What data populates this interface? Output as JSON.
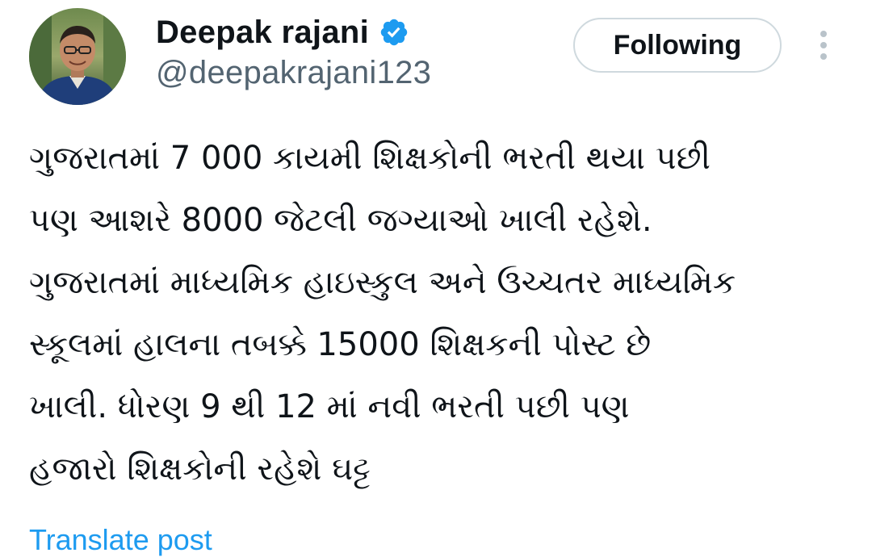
{
  "author": {
    "display_name": "Deepak rajani",
    "handle": "@deepakrajani123",
    "verified_icon": "verified-badge-icon",
    "verified_color": "#1d9bf0"
  },
  "actions": {
    "follow_label": "Following",
    "more_icon": "more-vertical-icon"
  },
  "tweet": {
    "lines": [
      "ગુજરાતમાં 7 000 કાયમી શિક્ષકોની ભરતી થયા પછી",
      "પણ આશરે 8000 જેટલી જગ્યાઓ ખાલી રહેશે.",
      "ગુજરાતમાં માધ્યમિક હાઇસ્કુલ અને ઉચ્ચતર માધ્યમિક",
      "સ્કૂલમાં હાલના તબક્કે 15000 શિક્ષકની પોસ્ટ છે",
      "ખાલી. ધોરણ 9 થી 12 માં નવી ભરતી પછી પણ",
      "હજારો શિક્ષકોની રહેશે ઘટ્ટ"
    ],
    "translate_label": "Translate post"
  },
  "colors": {
    "text_primary": "#0f1419",
    "text_secondary": "#536471",
    "link": "#1d9bf0",
    "button_border": "#cfd9de"
  }
}
